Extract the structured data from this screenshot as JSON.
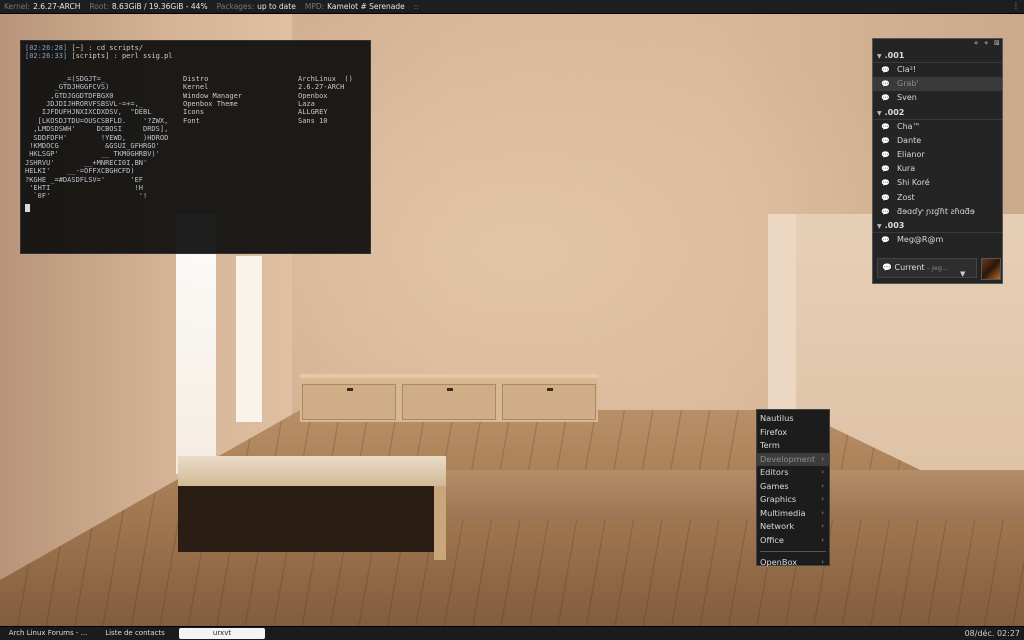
{
  "top_panel": {
    "items": [
      {
        "label": "Kernel:",
        "value": "2.6.27-ARCH"
      },
      {
        "label": "Root:",
        "value": "8.63GiB  / 19.36GiB - 44%"
      },
      {
        "label": "Packages:",
        "value": "up to date"
      },
      {
        "label": "MPD:",
        "value": "Kamelot # Serenade"
      }
    ],
    "end_glyph": "::"
  },
  "terminal": {
    "prompt1": {
      "time": "[02:26:28]",
      "rest": " [~] : cd scripts/"
    },
    "prompt2": {
      "time": "[02:26:33]",
      "rest": " [scripts] : perl ssig.pl"
    },
    "art_lines": [
      "         _=(SDGJT=_",
      "       _GTDJHGGFCVS)",
      "      ,GTDJGGDTDFBGX0",
      "     JDJDIJHRORVFSBSVL-=+=,_",
      "    IJFDUFHJNXIXCDXDSV,  \"DEBL",
      "   [LKOSDJTDU=OUSCSBFLD.    '?ZWX,",
      "  ,LMDSDSWH'     DCBOSI     DRDS],",
      "  SDDFDFH'        !YEWD,    )HDROD",
      " !KMDOCG           &GSUI_GFHRGO'",
      " HKLSGP'          __ TKM0GHRBV)'",
      "JSHRVU'       __+MNRECI0I,BN'",
      "HELKI'    __-=OFFXCBGHCFD)",
      "?KGHE _=#DASDFLSV='      'EF",
      " 'EHTI                    !H",
      "  `0F'                     '!"
    ],
    "info": [
      {
        "key": "Distro",
        "value": "ArchLinux  ()"
      },
      {
        "key": "Kernel",
        "value": "2.6.27-ARCH"
      },
      {
        "key": "Window Manager",
        "value": "Openbox"
      },
      {
        "key": "Openbox Theme",
        "value": "Laza"
      },
      {
        "key": "Icons",
        "value": "ALLGREY"
      },
      {
        "key": "Font",
        "value": "Sans 10"
      }
    ]
  },
  "buddy_list": {
    "controls": [
      "⋄",
      "⋄",
      "⊠"
    ],
    "groups": [
      {
        "name": ".001",
        "contacts": [
          "Cla²!",
          "Grab'",
          "Sven"
        ]
      },
      {
        "name": ".002",
        "contacts": [
          "Cha™",
          "Dante",
          "Elianor",
          "Kura",
          "Shi Koré",
          "Zost",
          "ƌɘɑɗƴ ɲɪɠɦt ƨɦɑƌɘ"
        ]
      },
      {
        "name": ".003",
        "contacts": [
          "Meg@R@m"
        ]
      }
    ],
    "status": {
      "label": "Current",
      "sub": " – Jeg..."
    }
  },
  "menu": {
    "items": [
      "Nautilus",
      "Firefox",
      "Term",
      "Development",
      "Editors",
      "Games",
      "Graphics",
      "Multimedia",
      "Network",
      "Office"
    ],
    "submenu_items": [
      "Development",
      "Editors",
      "Games",
      "Graphics",
      "Multimedia",
      "Network",
      "Office"
    ],
    "highlighted": "Development",
    "footer": "OpenBox"
  },
  "taskbar": {
    "tasks": [
      "Arch Linux Forums - ...",
      "Liste de contacts",
      "urxvt"
    ],
    "clock": "08/déc. 02:27"
  }
}
